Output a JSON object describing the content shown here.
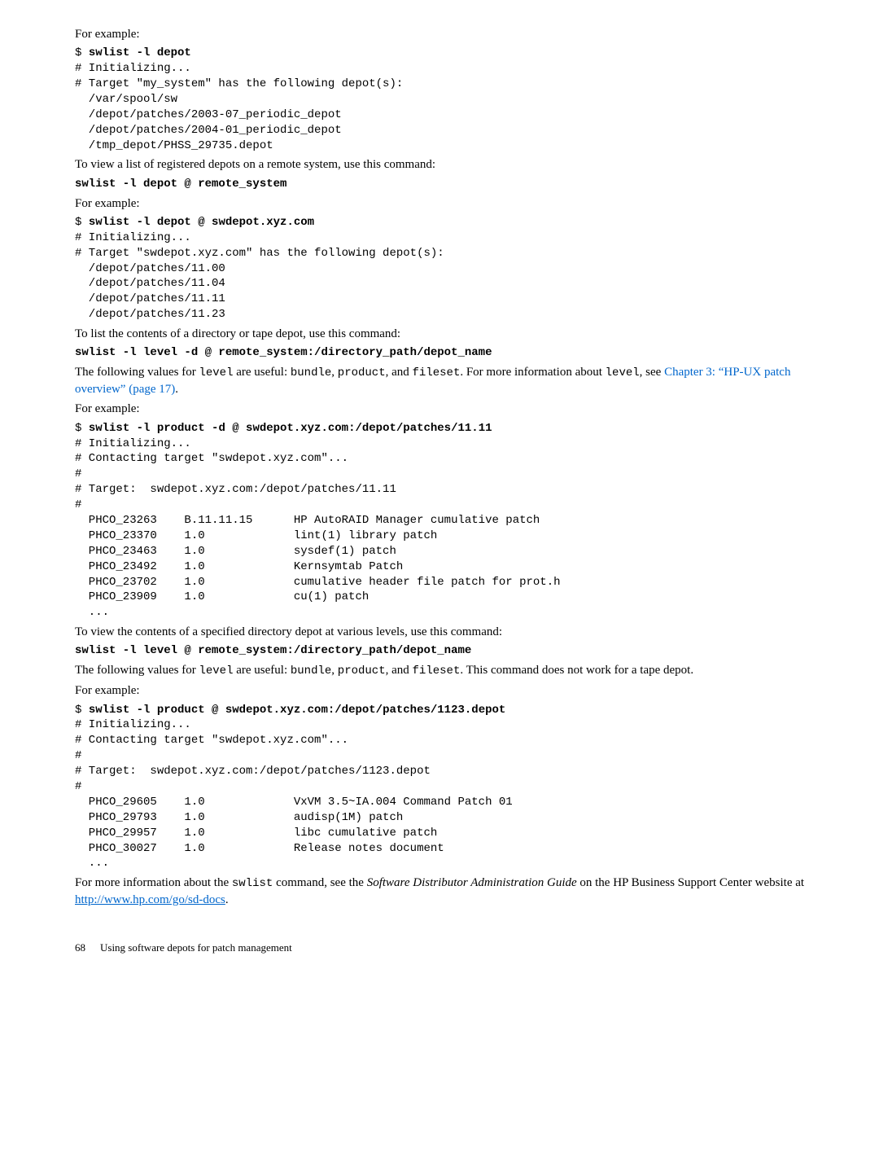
{
  "p1": "For example:",
  "cmd1_prompt": "$ ",
  "cmd1": "swlist -l depot",
  "block1": "# Initializing...\n# Target \"my_system\" has the following depot(s):\n  /var/spool/sw\n  /depot/patches/2003-07_periodic_depot\n  /depot/patches/2004-01_periodic_depot\n  /tmp_depot/PHSS_29735.depot",
  "p2": "To view a list of registered depots on a remote system, use this command:",
  "cmd2": "swlist -l depot @ remote_system",
  "p3": "For example:",
  "cmd3_prompt": "$ ",
  "cmd3": "swlist -l depot @ swdepot.xyz.com",
  "block3": "# Initializing...\n# Target \"swdepot.xyz.com\" has the following depot(s):\n  /depot/patches/11.00\n  /depot/patches/11.04\n  /depot/patches/11.11\n  /depot/patches/11.23",
  "p4": "To list the contents of a directory or tape depot, use this command:",
  "cmd4": "swlist -l level -d @ remote_system:/directory_path/depot_name",
  "p5a": "The following values for ",
  "p5b": "level",
  "p5c": " are useful: ",
  "p5d": "bundle",
  "p5e": ", ",
  "p5f": "product",
  "p5g": ", and ",
  "p5h": "fileset",
  "p5i": ". For more information about ",
  "p5j": "level",
  "p5k": ", see ",
  "p5l": "Chapter 3: “HP-UX patch overview” (page 17)",
  "p5m": ".",
  "p6": "For example:",
  "cmd5_prompt": "$ ",
  "cmd5": "swlist -l product -d @ swdepot.xyz.com:/depot/patches/11.11",
  "block5": "# Initializing...\n# Contacting target \"swdepot.xyz.com\"...\n#\n# Target:  swdepot.xyz.com:/depot/patches/11.11\n#\n  PHCO_23263    B.11.11.15      HP AutoRAID Manager cumulative patch\n  PHCO_23370    1.0             lint(1) library patch\n  PHCO_23463    1.0             sysdef(1) patch\n  PHCO_23492    1.0             Kernsymtab Patch\n  PHCO_23702    1.0             cumulative header file patch for prot.h\n  PHCO_23909    1.0             cu(1) patch\n  ...",
  "p7": "To view the contents of a specified directory depot at various levels, use this command:",
  "cmd6": "swlist -l level @ remote_system:/directory_path/depot_name",
  "p8a": "The following values for ",
  "p8b": "level",
  "p8c": " are useful: ",
  "p8d": "bundle",
  "p8e": ", ",
  "p8f": "product",
  "p8g": ", and ",
  "p8h": "fileset",
  "p8i": ". This command does not work for a tape depot.",
  "p9": "For example:",
  "cmd7_prompt": "$ ",
  "cmd7": "swlist -l product @ swdepot.xyz.com:/depot/patches/1123.depot",
  "block7": "# Initializing...\n# Contacting target \"swdepot.xyz.com\"...\n#\n# Target:  swdepot.xyz.com:/depot/patches/1123.depot\n#\n  PHCO_29605    1.0             VxVM 3.5~IA.004 Command Patch 01\n  PHCO_29793    1.0             audisp(1M) patch\n  PHCO_29957    1.0             libc cumulative patch\n  PHCO_30027    1.0             Release notes document\n  ...",
  "p10a": "For more information about the ",
  "p10b": "swlist",
  "p10c": " command, see the ",
  "p10d": "Software Distributor Administration Guide",
  "p10e": " on the HP Business Support Center website at ",
  "p10f": "http://www.hp.com/go/sd-docs",
  "p10g": ".",
  "footer_page": "68",
  "footer_text": "Using software depots for patch management"
}
